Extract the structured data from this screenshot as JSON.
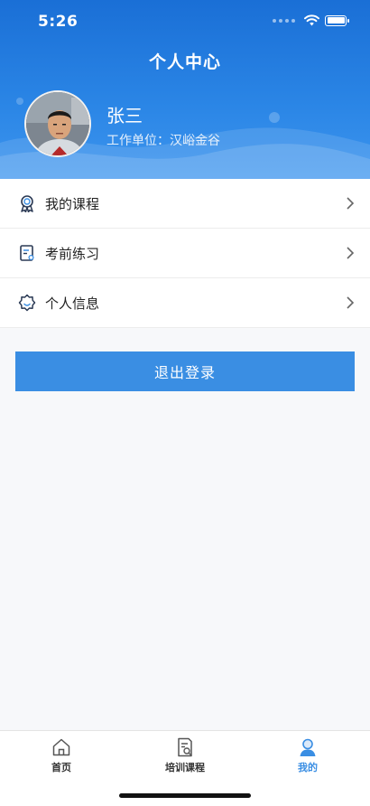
{
  "status_bar": {
    "time": "5:26"
  },
  "header": {
    "title": "个人中心",
    "user_name": "张三",
    "user_org": "工作单位：汉峪金谷"
  },
  "menu": {
    "items": [
      {
        "label": "我的课程",
        "icon": "award-icon"
      },
      {
        "label": "考前练习",
        "icon": "exam-doc-icon"
      },
      {
        "label": "个人信息",
        "icon": "profile-badge-icon"
      }
    ]
  },
  "logout_label": "退出登录",
  "tabbar": {
    "tabs": [
      {
        "label": "首页",
        "icon": "home-icon",
        "active": false
      },
      {
        "label": "培训课程",
        "icon": "course-search-icon",
        "active": false
      },
      {
        "label": "我的",
        "icon": "user-icon",
        "active": true
      }
    ]
  },
  "colors": {
    "primary": "#1a6fd6",
    "accent": "#3a8ee3",
    "background": "#f7f8fa"
  }
}
